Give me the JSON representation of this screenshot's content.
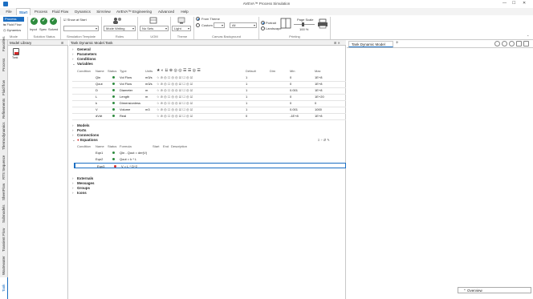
{
  "titlebar": {
    "title": "AVEVA™ Process Simulation",
    "minimize": "—",
    "maximize": "☐",
    "close": "✕"
  },
  "ribbon_tabs": [
    "File",
    "Start",
    "Process",
    "Fluid Flow",
    "Dynamics",
    "SimView",
    "AVEVA™ Engineering",
    "Advanced",
    "Help"
  ],
  "ribbon": {
    "mode": {
      "process": "Process",
      "fluid_flow": "Fluid Flow",
      "dynamics": "Dynamics",
      "label": "Mode"
    },
    "solution_status": {
      "input": "Input",
      "spec": "Spec",
      "solved": "Solved",
      "label": "Solution Status"
    },
    "simulation_template": {
      "show_at_start": "Show at Start",
      "label": "Simulation Template"
    },
    "roles": {
      "value": "Mode Writing",
      "label": "Roles"
    },
    "uom": {
      "value": "No Sets",
      "label": "UOM"
    },
    "theme": {
      "value": "Light",
      "label": "Theme"
    },
    "canvas_background": {
      "from_theme": "From Theme",
      "custom": "Custom",
      "value": "All",
      "label": "Canvas Background"
    },
    "printing": {
      "portrait": "Portrait",
      "landscape": "Landscape",
      "page_scale": "Page Scale",
      "scale_value": "100 %",
      "label": "Printing"
    }
  },
  "left_tabs": [
    "Favorites",
    "Process",
    "Fluid flow",
    "Refinements",
    "Thermodynamics",
    "RTS Sequence",
    "SheetFlow",
    "Submodels",
    "Transient Flow",
    "Wastewater",
    "Tank Dynamic Model"
  ],
  "library": {
    "title": "Model Library",
    "item": "Tank"
  },
  "editor": {
    "title": "Tank Dynamic Model.Tank",
    "sections_top": [
      "General",
      "Parameters",
      "Conditions",
      "Variables"
    ],
    "var_columns": [
      "Condition",
      "Name",
      "Status",
      "Type",
      "Units",
      "Default",
      "Dim",
      "Min",
      "Max"
    ],
    "variables": [
      {
        "name": "Qin",
        "status": "green",
        "type": "Vol Flow",
        "units": "m3/s",
        "default": "1",
        "min": "0",
        "max": "1E+8"
      },
      {
        "name": "Qout",
        "status": "green",
        "type": "Vol Flow",
        "units": "m3/s",
        "default": "1",
        "min": "0",
        "max": "1E+8"
      },
      {
        "name": "D",
        "status": "green",
        "type": "Diameter",
        "units": "m",
        "default": "1",
        "min": "0.001",
        "max": "1E+8"
      },
      {
        "name": "L",
        "status": "green",
        "type": "Length",
        "units": "m",
        "default": "1",
        "min": "0",
        "max": "1E+20"
      },
      {
        "name": "k",
        "status": "green",
        "type": "Dimensionless",
        "units": "",
        "default": "1",
        "min": "0",
        "max": "0"
      },
      {
        "name": "V",
        "status": "green",
        "type": "Volume",
        "units": "m3",
        "default": "1",
        "min": "0.001",
        "max": "1000"
      },
      {
        "name": "dVdt",
        "status": "green",
        "type": "Real",
        "units": "",
        "default": "0",
        "min": "-1E+8",
        "max": "1E+8"
      }
    ],
    "sections_mid": [
      "Models",
      "Ports",
      "Connections",
      "Equations"
    ],
    "eq_columns": [
      "Condition",
      "Name",
      "Status",
      "Formula",
      "Start",
      "End",
      "Description"
    ],
    "equations": [
      {
        "name": "Eqn1",
        "status": "green",
        "formula": "Qin - Qout = der(V)"
      },
      {
        "name": "Eqn2",
        "status": "green",
        "formula": "Qout = k * L"
      },
      {
        "name": "Eqn3",
        "status": "red",
        "formula": "V = L * D^2"
      }
    ],
    "sections_bottom": [
      "Externals",
      "Messages",
      "Groups",
      "Icons"
    ]
  },
  "right": {
    "tab": "Tank Dynamic Model",
    "add": "+",
    "overview": "Overview"
  },
  "colors": {
    "accent": "#1b6ec2",
    "ok": "#2e8b3e",
    "error": "#d62828"
  }
}
